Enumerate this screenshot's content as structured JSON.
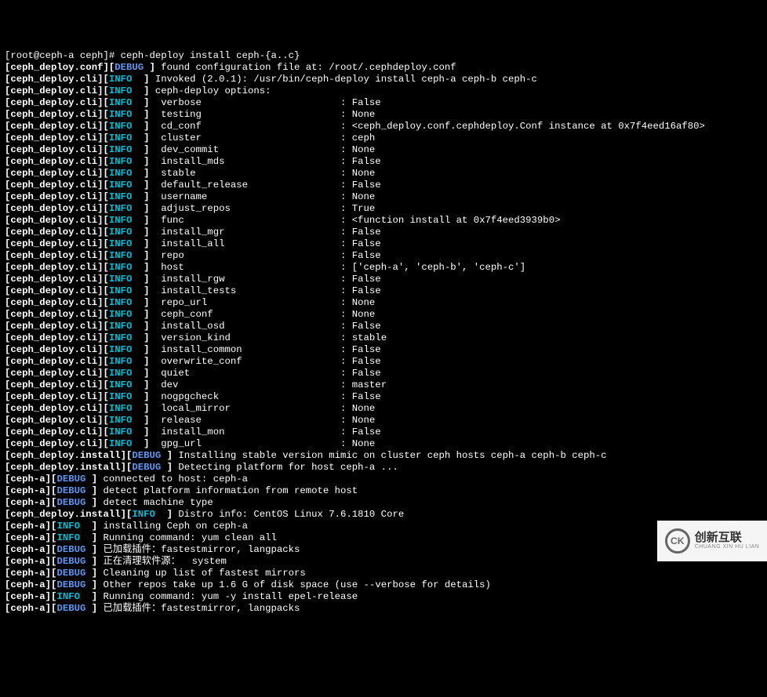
{
  "prompt": {
    "user": "root",
    "host": "ceph-a",
    "cwd": "ceph",
    "command": "ceph-deploy install ceph-{a..c}"
  },
  "conf_line": {
    "logger": "ceph_deploy.conf",
    "level": "DEBUG",
    "msg": "found configuration file at: /root/.cephdeploy.conf"
  },
  "invoked_line": {
    "logger": "ceph_deploy.cli",
    "level": "INFO",
    "msg": "Invoked (2.0.1): /usr/bin/ceph-deploy install ceph-a ceph-b ceph-c"
  },
  "options_header": {
    "logger": "ceph_deploy.cli",
    "level": "INFO",
    "msg": "ceph-deploy options:"
  },
  "options": [
    {
      "logger": "ceph_deploy.cli",
      "level": "INFO",
      "key": "verbose",
      "value": "False"
    },
    {
      "logger": "ceph_deploy.cli",
      "level": "INFO",
      "key": "testing",
      "value": "None"
    },
    {
      "logger": "ceph_deploy.cli",
      "level": "INFO",
      "key": "cd_conf",
      "value": "<ceph_deploy.conf.cephdeploy.Conf instance at 0x7f4eed16af80>"
    },
    {
      "logger": "ceph_deploy.cli",
      "level": "INFO",
      "key": "cluster",
      "value": "ceph"
    },
    {
      "logger": "ceph_deploy.cli",
      "level": "INFO",
      "key": "dev_commit",
      "value": "None"
    },
    {
      "logger": "ceph_deploy.cli",
      "level": "INFO",
      "key": "install_mds",
      "value": "False"
    },
    {
      "logger": "ceph_deploy.cli",
      "level": "INFO",
      "key": "stable",
      "value": "None"
    },
    {
      "logger": "ceph_deploy.cli",
      "level": "INFO",
      "key": "default_release",
      "value": "False"
    },
    {
      "logger": "ceph_deploy.cli",
      "level": "INFO",
      "key": "username",
      "value": "None"
    },
    {
      "logger": "ceph_deploy.cli",
      "level": "INFO",
      "key": "adjust_repos",
      "value": "True"
    },
    {
      "logger": "ceph_deploy.cli",
      "level": "INFO",
      "key": "func",
      "value": "<function install at 0x7f4eed3939b0>"
    },
    {
      "logger": "ceph_deploy.cli",
      "level": "INFO",
      "key": "install_mgr",
      "value": "False"
    },
    {
      "logger": "ceph_deploy.cli",
      "level": "INFO",
      "key": "install_all",
      "value": "False"
    },
    {
      "logger": "ceph_deploy.cli",
      "level": "INFO",
      "key": "repo",
      "value": "False"
    },
    {
      "logger": "ceph_deploy.cli",
      "level": "INFO",
      "key": "host",
      "value": "['ceph-a', 'ceph-b', 'ceph-c']"
    },
    {
      "logger": "ceph_deploy.cli",
      "level": "INFO",
      "key": "install_rgw",
      "value": "False"
    },
    {
      "logger": "ceph_deploy.cli",
      "level": "INFO",
      "key": "install_tests",
      "value": "False"
    },
    {
      "logger": "ceph_deploy.cli",
      "level": "INFO",
      "key": "repo_url",
      "value": "None"
    },
    {
      "logger": "ceph_deploy.cli",
      "level": "INFO",
      "key": "ceph_conf",
      "value": "None"
    },
    {
      "logger": "ceph_deploy.cli",
      "level": "INFO",
      "key": "install_osd",
      "value": "False"
    },
    {
      "logger": "ceph_deploy.cli",
      "level": "INFO",
      "key": "version_kind",
      "value": "stable"
    },
    {
      "logger": "ceph_deploy.cli",
      "level": "INFO",
      "key": "install_common",
      "value": "False"
    },
    {
      "logger": "ceph_deploy.cli",
      "level": "INFO",
      "key": "overwrite_conf",
      "value": "False"
    },
    {
      "logger": "ceph_deploy.cli",
      "level": "INFO",
      "key": "quiet",
      "value": "False"
    },
    {
      "logger": "ceph_deploy.cli",
      "level": "INFO",
      "key": "dev",
      "value": "master"
    },
    {
      "logger": "ceph_deploy.cli",
      "level": "INFO",
      "key": "nogpgcheck",
      "value": "False"
    },
    {
      "logger": "ceph_deploy.cli",
      "level": "INFO",
      "key": "local_mirror",
      "value": "None"
    },
    {
      "logger": "ceph_deploy.cli",
      "level": "INFO",
      "key": "release",
      "value": "None"
    },
    {
      "logger": "ceph_deploy.cli",
      "level": "INFO",
      "key": "install_mon",
      "value": "False"
    },
    {
      "logger": "ceph_deploy.cli",
      "level": "INFO",
      "key": "gpg_url",
      "value": "None"
    }
  ],
  "trailing": [
    {
      "logger": "ceph_deploy.install",
      "level": "DEBUG",
      "msg": "Installing stable version mimic on cluster ceph hosts ceph-a ceph-b ceph-c"
    },
    {
      "logger": "ceph_deploy.install",
      "level": "DEBUG",
      "msg": "Detecting platform for host ceph-a ..."
    },
    {
      "logger": "ceph-a",
      "level": "DEBUG",
      "msg": "connected to host: ceph-a"
    },
    {
      "logger": "ceph-a",
      "level": "DEBUG",
      "msg": "detect platform information from remote host"
    },
    {
      "logger": "ceph-a",
      "level": "DEBUG",
      "msg": "detect machine type"
    },
    {
      "logger": "ceph_deploy.install",
      "level": "INFO",
      "msg": "Distro info: CentOS Linux 7.6.1810 Core"
    },
    {
      "logger": "ceph-a",
      "level": "INFO",
      "msg": "installing Ceph on ceph-a"
    },
    {
      "logger": "ceph-a",
      "level": "INFO",
      "msg": "Running command: yum clean all"
    },
    {
      "logger": "ceph-a",
      "level": "DEBUG",
      "msg": "已加载插件：fastestmirror, langpacks"
    },
    {
      "logger": "ceph-a",
      "level": "DEBUG",
      "msg": "正在清理软件源：  system"
    },
    {
      "logger": "ceph-a",
      "level": "DEBUG",
      "msg": "Cleaning up list of fastest mirrors"
    },
    {
      "logger": "ceph-a",
      "level": "DEBUG",
      "msg": "Other repos take up 1.6 G of disk space (use --verbose for details)"
    },
    {
      "logger": "ceph-a",
      "level": "INFO",
      "msg": "Running command: yum -y install epel-release"
    },
    {
      "logger": "ceph-a",
      "level": "DEBUG",
      "msg": "已加载插件：fastestmirror, langpacks"
    }
  ],
  "watermark": {
    "glyph": "CK",
    "zh": "创新互联",
    "py": "CHUANG XIN HU LIAN"
  }
}
